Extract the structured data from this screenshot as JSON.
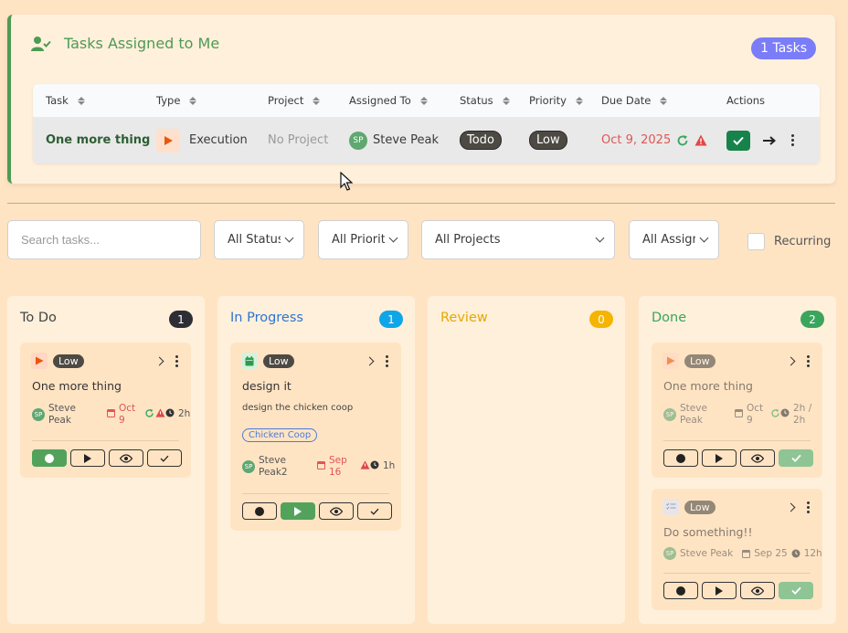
{
  "assigned": {
    "title": "Tasks Assigned to Me",
    "count_label": "1 Tasks",
    "columns": [
      "Task",
      "Type",
      "Project",
      "Assigned To",
      "Status",
      "Priority",
      "Due Date",
      "Actions"
    ],
    "row": {
      "task": "One more thing",
      "type": "Execution",
      "project": "No Project",
      "assignee_initials": "SP",
      "assignee": "Steve Peak",
      "status": "Todo",
      "priority": "Low",
      "due_date": "Oct 9, 2025"
    }
  },
  "filters": {
    "search_placeholder": "Search tasks...",
    "status": "All Status",
    "priority": "All Priority",
    "projects": "All Projects",
    "assignees": "All Assignees",
    "recurring_label": "Recurring"
  },
  "columns": {
    "todo": {
      "title": "To Do",
      "count": "1",
      "color": "#2d2e35"
    },
    "in_progress": {
      "title": "In Progress",
      "count": "1",
      "color": "#0ea5e9"
    },
    "review": {
      "title": "Review",
      "count": "0",
      "color": "#f5b400"
    },
    "done": {
      "title": "Done",
      "count": "2",
      "color": "#3aa55d"
    }
  },
  "cards": {
    "todo_1": {
      "priority": "Low",
      "title": "One more thing",
      "assignee_initials": "SP",
      "assignee_line1": "Steve",
      "assignee_line2": "Peak",
      "date_line1": "Oct",
      "date_line2": "9",
      "time": "2h"
    },
    "progress_1": {
      "priority": "Low",
      "title": "design it",
      "description": "design the chicken coop",
      "project_tag": "Chicken Coop",
      "assignee_initials": "SP",
      "assignee_line1": "Steve",
      "assignee_line2": "Peak2",
      "date_line1": "Sep",
      "date_line2": "16",
      "time": "1h"
    },
    "done_1": {
      "priority": "Low",
      "title": "One more thing",
      "assignee_initials": "SP",
      "assignee_line1": "Steve",
      "assignee_line2": "Peak",
      "date_line1": "Oct",
      "date_line2": "9",
      "time_line1": "2h",
      "time_line2": "/",
      "time_line3": "2h"
    },
    "done_2": {
      "priority": "Low",
      "title": "Do something!!",
      "assignee_initials": "SP",
      "assignee": "Steve Peak",
      "date": "Sep 25",
      "time": "12h"
    }
  },
  "colors": {
    "background": "#ffe4c4",
    "panel": "#fff0db",
    "accent_green": "#4e9a55",
    "badge_purple": "#7b7cf7",
    "due_red": "#e05555"
  },
  "icons": [
    "user-check-icon",
    "execution-icon",
    "calendar-icon",
    "checklist-icon",
    "recur-icon",
    "warning-icon",
    "clock-icon",
    "check-icon",
    "arrow-right-icon",
    "kebab-icon",
    "chevron-down-icon"
  ]
}
